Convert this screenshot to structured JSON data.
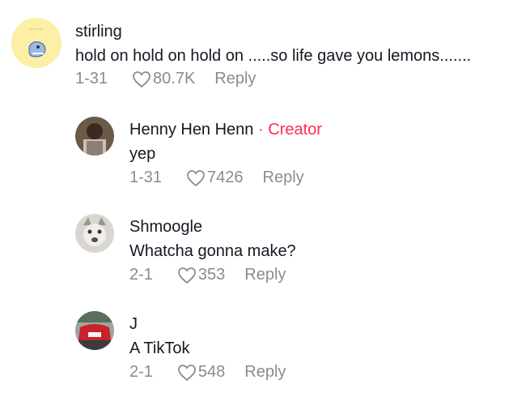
{
  "comments": [
    {
      "username": "stirling",
      "text": "hold on hold on hold on .....so life gave you lemons.......",
      "date": "1-31",
      "likes": "80.7K",
      "reply_label": "Reply"
    }
  ],
  "replies": [
    {
      "username": "Henny Hen Henn",
      "creator_badge": "· Creator",
      "text": "yep",
      "date": "1-31",
      "likes": "7426",
      "reply_label": "Reply"
    },
    {
      "username": "Shmoogle",
      "text": "Whatcha gonna make?",
      "date": "2-1",
      "likes": "353",
      "reply_label": "Reply"
    },
    {
      "username": "J",
      "text": "A TikTok",
      "date": "2-1",
      "likes": "548",
      "reply_label": "Reply"
    }
  ],
  "colors": {
    "creator": "#fe2c55",
    "meta": "#8a8b91",
    "text": "#161823"
  },
  "icons": {
    "like": "heart-outline-icon"
  }
}
